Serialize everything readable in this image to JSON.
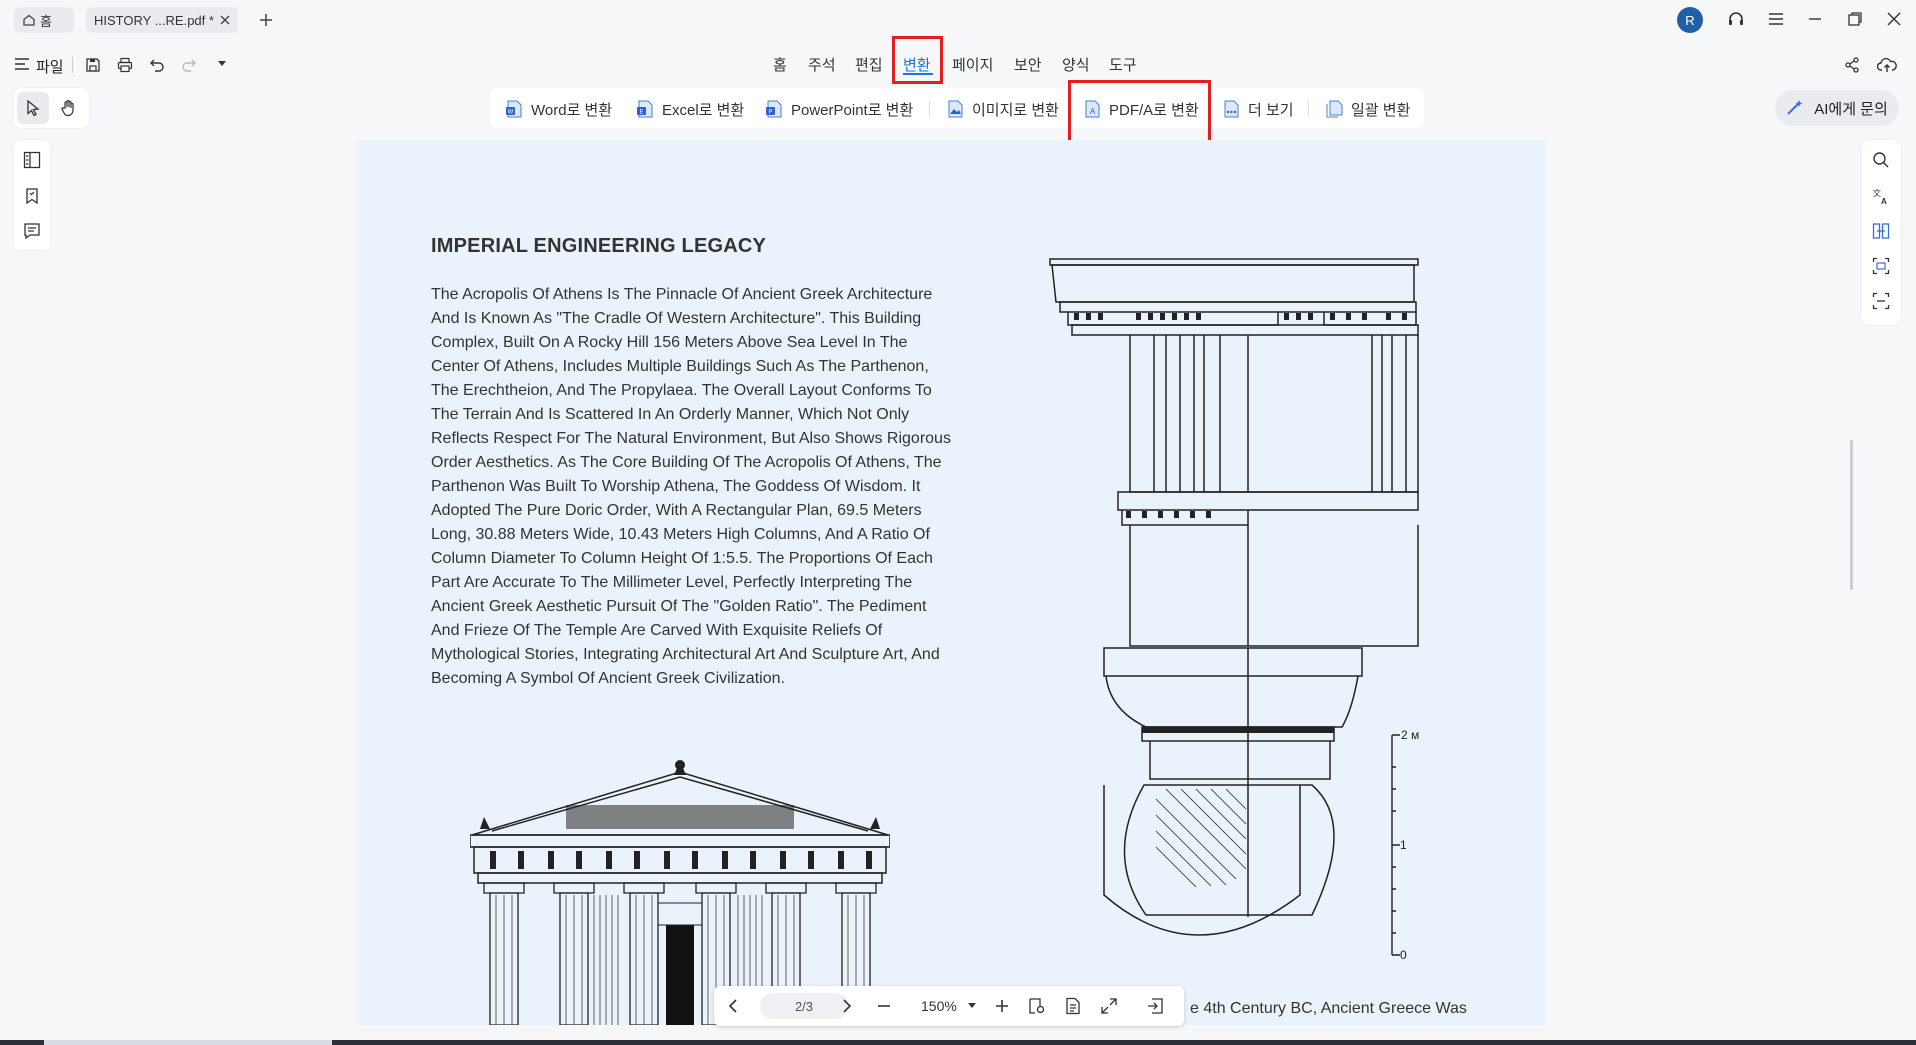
{
  "tabs": {
    "home": "홈",
    "document": "HISTORY ...RE.pdf *"
  },
  "user": {
    "avatar_letter": "R"
  },
  "toolbar": {
    "file_label": "파일"
  },
  "menu": [
    "홈",
    "주석",
    "편집",
    "변환",
    "페이지",
    "보안",
    "양식",
    "도구"
  ],
  "convert": {
    "word": "Word로 변환",
    "excel": "Excel로 변환",
    "ppt": "PowerPoint로 변환",
    "image": "이미지로 변환",
    "pdfa": "PDF/A로 변환",
    "more": "더 보기",
    "batch": "일괄 변환"
  },
  "ai": {
    "label": "AI에게 문의"
  },
  "document": {
    "title": "IMPERIAL ENGINEERING LEGACY",
    "body": "The Acropolis Of Athens Is The Pinnacle Of Ancient Greek Architecture And Is Known As \"The Cradle Of Western Architecture\". This Building Complex, Built On A Rocky Hill 156 Meters Above Sea Level In The Center Of Athens, Includes Multiple Buildings Such As The Parthenon, The Erechtheion, And The Propylaea. The Overall Layout Conforms To The Terrain And Is Scattered In An Orderly Manner, Which Not Only Reflects Respect For The Natural Environment, But Also Shows Rigorous Order Aesthetics. As The Core Building Of The Acropolis Of Athens, The Parthenon Was Built To Worship Athena, The Goddess Of Wisdom. It Adopted The Pure Doric Order, With A Rectangular Plan, 69.5 Meters Long, 30.88 Meters Wide, 10.43 Meters High Columns, And A Ratio Of Column Diameter To Column Height Of 1:5.5. The Proportions Of Each Part Are Accurate To The Millimeter Level, Perfectly Interpreting The Ancient Greek Aesthetic Pursuit Of The \"Golden Ratio\". The Pediment And Frieze Of The Temple Are Carved With Exquisite Reliefs Of Mythological Stories, Integrating Architectural Art And Sculpture Art, And Becoming A Symbol Of Ancient Greek Civilization.",
    "partial_text": "e 4th Century BC, Ancient Greece Was",
    "scale_labels": [
      "2 м",
      "1",
      "0"
    ]
  },
  "nav": {
    "page_indicator": "2/3",
    "zoom": "150%"
  },
  "colors": {
    "accent": "#1a73e8",
    "highlight_box": "#e02020",
    "avatar": "#1f5fa8",
    "page_bg": "#eaf3fb"
  }
}
